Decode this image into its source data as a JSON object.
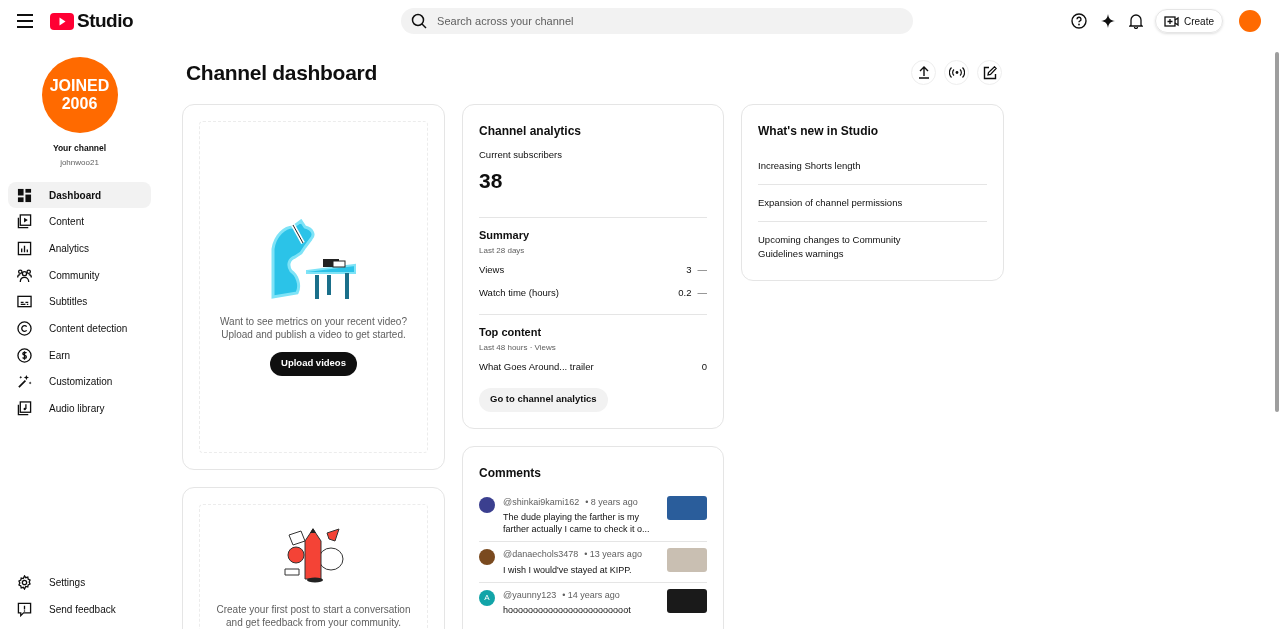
{
  "header": {
    "logo_text": "Studio",
    "search": {
      "placeholder": "Search across your channel"
    },
    "create_label": "Create"
  },
  "sidebar": {
    "avatar_text": [
      "JOINED",
      "2006"
    ],
    "channel_label": "Your channel",
    "handle": "johnwoo21",
    "items": [
      {
        "label": "Dashboard",
        "selected": true
      },
      {
        "label": "Content",
        "selected": false
      },
      {
        "label": "Analytics",
        "selected": false
      },
      {
        "label": "Community",
        "selected": false
      },
      {
        "label": "Subtitles",
        "selected": false
      },
      {
        "label": "Content detection",
        "selected": false
      },
      {
        "label": "Earn",
        "selected": false
      },
      {
        "label": "Customization",
        "selected": false
      },
      {
        "label": "Audio library",
        "selected": false
      }
    ],
    "footer_items": [
      {
        "label": "Settings"
      },
      {
        "label": "Send feedback"
      }
    ]
  },
  "page_title": "Channel dashboard",
  "video_card": {
    "message": "Want to see metrics on your recent video? Upload and publish a video to get started.",
    "button": "Upload videos"
  },
  "post_card": {
    "message": "Create your first post to start a conversation and get feedback from your community."
  },
  "analytics": {
    "title": "Channel analytics",
    "subscribers_label": "Current subscribers",
    "subscribers": "38",
    "summary": {
      "title": "Summary",
      "period": "Last 28 days",
      "rows": [
        {
          "label": "Views",
          "value": "3",
          "trend": "—"
        },
        {
          "label": "Watch time (hours)",
          "value": "0.2",
          "trend": "—"
        }
      ]
    },
    "top_content": {
      "title": "Top content",
      "period": "Last 48 hours · Views",
      "rows": [
        {
          "label": "What Goes Around... trailer",
          "value": "0"
        }
      ]
    },
    "button": "Go to channel analytics"
  },
  "comments": {
    "title": "Comments",
    "items": [
      {
        "author": "@shinkai9kami162",
        "time": "• 8 years ago",
        "text": "The dude playing the farther is my farther actually I came to check it o..."
      },
      {
        "author": "@danaechols3478",
        "time": "• 13 years ago",
        "text": "I wish I would've stayed at KIPP."
      },
      {
        "author": "@yaunny123",
        "time": "• 14 years ago",
        "text": "hoooooooooooooooooooooooot",
        "avatar_letter": "A"
      }
    ]
  },
  "news": {
    "title": "What's new in Studio",
    "items": [
      "Increasing Shorts length",
      "Expansion of channel permissions",
      "Upcoming changes to Community Guidelines warnings"
    ]
  }
}
